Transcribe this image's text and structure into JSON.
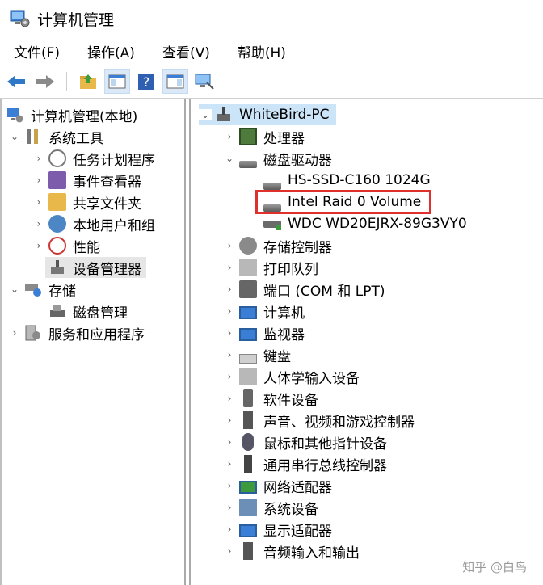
{
  "window": {
    "title": "计算机管理"
  },
  "menu": [
    "文件(F)",
    "操作(A)",
    "查看(V)",
    "帮助(H)"
  ],
  "toolbar": [
    "back-icon",
    "forward-icon",
    "up-folder-icon",
    "show-hide-tree-icon",
    "help-icon",
    "properties-icon",
    "monitor-icon"
  ],
  "left_tree": [
    {
      "label": "计算机管理(本地)",
      "chev": ""
    },
    {
      "label": "系统工具",
      "chev": "v"
    },
    {
      "label": "任务计划程序",
      "chev": ">"
    },
    {
      "label": "事件查看器",
      "chev": ">"
    },
    {
      "label": "共享文件夹",
      "chev": ">"
    },
    {
      "label": "本地用户和组",
      "chev": ">"
    },
    {
      "label": "性能",
      "chev": ">"
    },
    {
      "label": "设备管理器",
      "chev": ""
    },
    {
      "label": "存储",
      "chev": "v"
    },
    {
      "label": "磁盘管理",
      "chev": ""
    },
    {
      "label": "服务和应用程序",
      "chev": ">"
    }
  ],
  "right_tree": [
    {
      "label": "WhiteBird-PC",
      "chev": "v"
    },
    {
      "label": "处理器",
      "chev": ">"
    },
    {
      "label": "磁盘驱动器",
      "chev": "v"
    },
    {
      "label": "HS-SSD-C160 1024G",
      "chev": ""
    },
    {
      "label": "Intel Raid 0 Volume",
      "chev": ""
    },
    {
      "label": "WDC WD20EJRX-89G3VY0",
      "chev": ""
    },
    {
      "label": "存储控制器",
      "chev": ">"
    },
    {
      "label": "打印队列",
      "chev": ">"
    },
    {
      "label": "端口 (COM 和 LPT)",
      "chev": ">"
    },
    {
      "label": "计算机",
      "chev": ">"
    },
    {
      "label": "监视器",
      "chev": ">"
    },
    {
      "label": "键盘",
      "chev": ">"
    },
    {
      "label": "人体学输入设备",
      "chev": ">"
    },
    {
      "label": "软件设备",
      "chev": ">"
    },
    {
      "label": "声音、视频和游戏控制器",
      "chev": ">"
    },
    {
      "label": "鼠标和其他指针设备",
      "chev": ">"
    },
    {
      "label": "通用串行总线控制器",
      "chev": ">"
    },
    {
      "label": "网络适配器",
      "chev": ">"
    },
    {
      "label": "系统设备",
      "chev": ">"
    },
    {
      "label": "显示适配器",
      "chev": ">"
    },
    {
      "label": "音频输入和输出",
      "chev": ">"
    }
  ],
  "watermark": "知乎 @白鸟",
  "colors": {
    "highlight_box": "#e0302c",
    "selected_bg": "#cce4f7",
    "left_selected_bg": "#e6e6e6"
  }
}
